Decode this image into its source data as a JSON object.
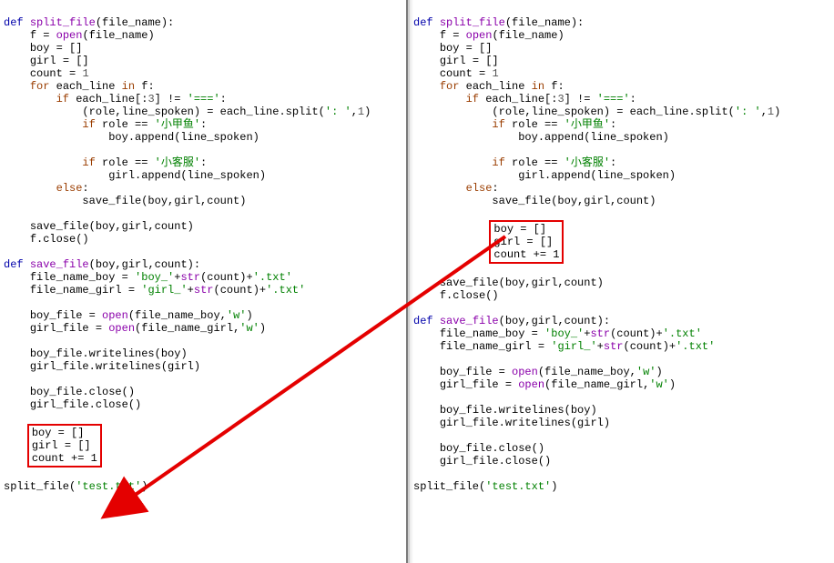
{
  "left": {
    "l1": {
      "def": "def",
      "fn": "split_file",
      "lp": "(",
      "p1": "file_name",
      "rp": "):"
    },
    "l2": {
      "v": "f",
      "eq": " = ",
      "fn": "open",
      "lp": "(",
      "a": "file_name",
      "rp": ")"
    },
    "l3": {
      "v": "boy",
      "eq": " = []"
    },
    "l4": {
      "v": "girl",
      "eq": " = []"
    },
    "l5": {
      "v": "count",
      "eq": " = ",
      "n": "1"
    },
    "l6": {
      "kw": "for",
      "v": "each_line",
      "in": "in",
      "it": "f:"
    },
    "l7": {
      "kw": "if",
      "expr": "each_line[:",
      "n": "3",
      "mid": "] != ",
      "s": "'==='",
      "c": ":"
    },
    "l8": {
      "lhs": "(role,line_spoken) = each_line.split(",
      "s": "': '",
      "cm": ",",
      "n": "1",
      "rp": ")"
    },
    "l9": {
      "kw": "if",
      "expr": "role == ",
      "s": "'小甲鱼'",
      "c": ":"
    },
    "l10": {
      "call": "boy.append(line_spoken)"
    },
    "l11": {
      "kw": "if",
      "expr": "role == ",
      "s": "'小客服'",
      "c": ":"
    },
    "l12": {
      "call": "girl.append(line_spoken)"
    },
    "l13": {
      "kw": "else",
      "c": ":"
    },
    "l14": {
      "call": "save_file(boy,girl,count)"
    },
    "l15": {
      "call": "save_file(boy,girl,count)"
    },
    "l16": {
      "call": "f.close()"
    },
    "l17": {
      "def": "def",
      "fn": "save_file",
      "lp": "(",
      "p": "boy,girl,count",
      "rp": "):"
    },
    "l18": {
      "v": "file_name_boy",
      "eq": " = ",
      "s1": "'boy_'",
      "p1": "+",
      "fn": "str",
      "lp": "(",
      "a": "count",
      "rp": ")+",
      "s2": "'.txt'"
    },
    "l19": {
      "v": "file_name_girl",
      "eq": " = ",
      "s1": "'girl_'",
      "p1": "+",
      "fn": "str",
      "lp": "(",
      "a": "count",
      "rp": ")+",
      "s2": "'.txt'"
    },
    "l20": {
      "v": "boy_file",
      "eq": " = ",
      "fn": "open",
      "lp": "(",
      "a": "file_name_boy,",
      "s": "'w'",
      "rp": ")"
    },
    "l21": {
      "v": "girl_file",
      "eq": " = ",
      "fn": "open",
      "lp": "(",
      "a": "file_name_girl,",
      "s": "'w'",
      "rp": ")"
    },
    "l22": {
      "call": "boy_file.writelines(boy)"
    },
    "l23": {
      "call": "girl_file.writelines(girl)"
    },
    "l24": {
      "call": "boy_file.close()"
    },
    "l25": {
      "call": "girl_file.close()"
    },
    "box": {
      "b1": "boy = []",
      "b2": "girl = []",
      "b3": "count += 1"
    },
    "l26": {
      "call": "split_file(",
      "s": "'test.txt'",
      "rp": ")"
    }
  },
  "right": {
    "l1": {
      "def": "def",
      "fn": "split_file",
      "lp": "(",
      "p1": "file_name",
      "rp": "):"
    },
    "l2": {
      "v": "f",
      "eq": " = ",
      "fn": "open",
      "lp": "(",
      "a": "file_name",
      "rp": ")"
    },
    "l3": {
      "v": "boy",
      "eq": " = []"
    },
    "l4": {
      "v": "girl",
      "eq": " = []"
    },
    "l5": {
      "v": "count",
      "eq": " = ",
      "n": "1"
    },
    "l6": {
      "kw": "for",
      "v": "each_line",
      "in": "in",
      "it": "f:"
    },
    "l7": {
      "kw": "if",
      "expr": "each_line[:",
      "n": "3",
      "mid": "] != ",
      "s": "'==='",
      "c": ":"
    },
    "l8": {
      "lhs": "(role,line_spoken) = each_line.split(",
      "s": "': '",
      "cm": ",",
      "n": "1",
      "rp": ")"
    },
    "l9": {
      "kw": "if",
      "expr": "role == ",
      "s": "'小甲鱼'",
      "c": ":"
    },
    "l10": {
      "call": "boy.append(line_spoken)"
    },
    "l11": {
      "kw": "if",
      "expr": "role == ",
      "s": "'小客服'",
      "c": ":"
    },
    "l12": {
      "call": "girl.append(line_spoken)"
    },
    "l13": {
      "kw": "else",
      "c": ":"
    },
    "l14": {
      "call": "save_file(boy,girl,count)"
    },
    "box": {
      "b1": "boy = []",
      "b2": "girl = []",
      "b3": "count += 1"
    },
    "l15": {
      "call": "save_file(boy,girl,count)"
    },
    "l16": {
      "call": "f.close()"
    },
    "l17": {
      "def": "def",
      "fn": "save_file",
      "lp": "(",
      "p": "boy,girl,count",
      "rp": "):"
    },
    "l18": {
      "v": "file_name_boy",
      "eq": " = ",
      "s1": "'boy_'",
      "p1": "+",
      "fn": "str",
      "lp": "(",
      "a": "count",
      "rp": ")+",
      "s2": "'.txt'"
    },
    "l19": {
      "v": "file_name_girl",
      "eq": " = ",
      "s1": "'girl_'",
      "p1": "+",
      "fn": "str",
      "lp": "(",
      "a": "count",
      "rp": ")+",
      "s2": "'.txt'"
    },
    "l20": {
      "v": "boy_file",
      "eq": " = ",
      "fn": "open",
      "lp": "(",
      "a": "file_name_boy,",
      "s": "'w'",
      "rp": ")"
    },
    "l21": {
      "v": "girl_file",
      "eq": " = ",
      "fn": "open",
      "lp": "(",
      "a": "file_name_girl,",
      "s": "'w'",
      "rp": ")"
    },
    "l22": {
      "call": "boy_file.writelines(boy)"
    },
    "l23": {
      "call": "girl_file.writelines(girl)"
    },
    "l24": {
      "call": "boy_file.close()"
    },
    "l25": {
      "call": "girl_file.close()"
    },
    "l26": {
      "call": "split_file(",
      "s": "'test.txt'",
      "rp": ")"
    }
  },
  "arrow": {
    "color": "#e40000"
  }
}
